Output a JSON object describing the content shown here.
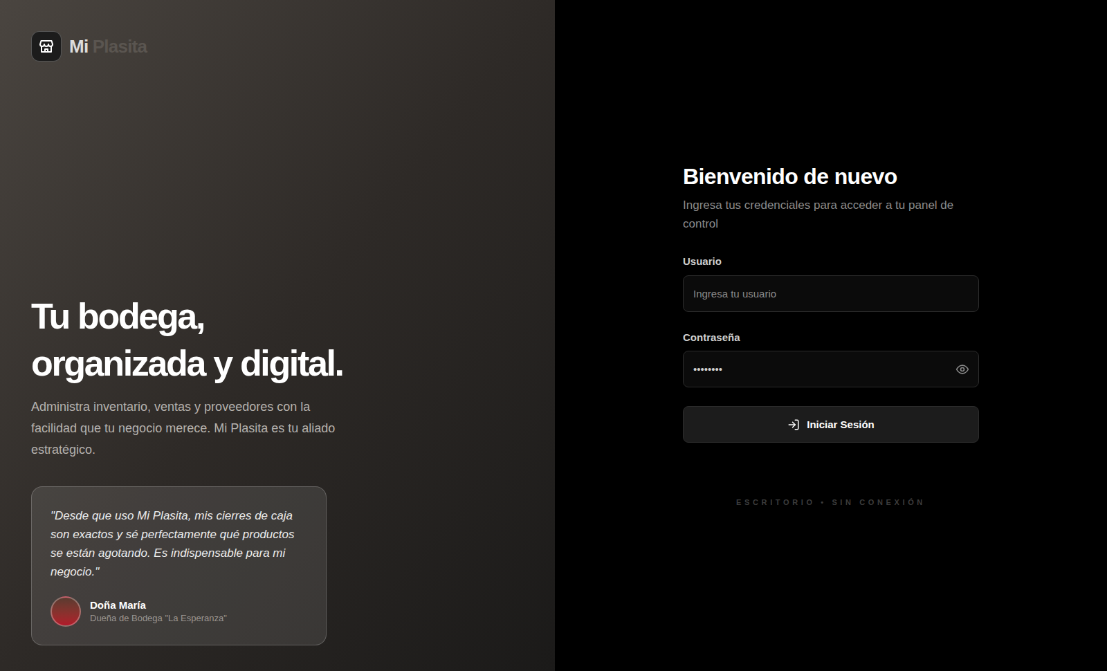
{
  "brand": {
    "name_primary": "Mi",
    "name_secondary": "Plasita"
  },
  "hero": {
    "headline": [
      "Tu bodega,",
      "organizada y digital."
    ],
    "subtitle": "Administra inventario, ventas y proveedores con la facilidad que tu negocio merece. Mi Plasita es tu aliado estratégico."
  },
  "testimonial": {
    "quote": "\"Desde que uso Mi Plasita, mis cierres de caja son exactos y sé perfectamente qué productos se están agotando. Es indispensable para mi negocio.\"",
    "author": "Doña María",
    "role": "Dueña de Bodega \"La Esperanza\""
  },
  "login": {
    "title": "Bienvenido de nuevo",
    "subtitle": "Ingresa tus credenciales para acceder a tu panel de control",
    "username": {
      "label": "Usuario",
      "placeholder": "Ingresa tu usuario"
    },
    "password": {
      "label": "Contraseña",
      "value": "••••••••",
      "masked": true
    },
    "button": "Iniciar Sesión",
    "footer": "ESCRITORIO • SIN CONEXIÓN"
  }
}
